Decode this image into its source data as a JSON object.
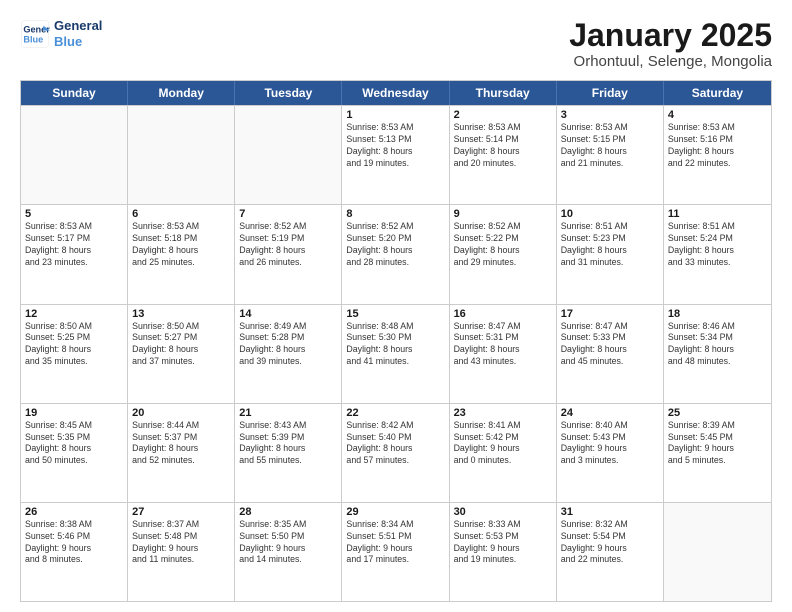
{
  "header": {
    "logo_line1": "General",
    "logo_line2": "Blue",
    "title": "January 2025",
    "subtitle": "Orhontuul, Selenge, Mongolia"
  },
  "weekdays": [
    "Sunday",
    "Monday",
    "Tuesday",
    "Wednesday",
    "Thursday",
    "Friday",
    "Saturday"
  ],
  "weeks": [
    [
      {
        "day": "",
        "info": ""
      },
      {
        "day": "",
        "info": ""
      },
      {
        "day": "",
        "info": ""
      },
      {
        "day": "1",
        "info": "Sunrise: 8:53 AM\nSunset: 5:13 PM\nDaylight: 8 hours\nand 19 minutes."
      },
      {
        "day": "2",
        "info": "Sunrise: 8:53 AM\nSunset: 5:14 PM\nDaylight: 8 hours\nand 20 minutes."
      },
      {
        "day": "3",
        "info": "Sunrise: 8:53 AM\nSunset: 5:15 PM\nDaylight: 8 hours\nand 21 minutes."
      },
      {
        "day": "4",
        "info": "Sunrise: 8:53 AM\nSunset: 5:16 PM\nDaylight: 8 hours\nand 22 minutes."
      }
    ],
    [
      {
        "day": "5",
        "info": "Sunrise: 8:53 AM\nSunset: 5:17 PM\nDaylight: 8 hours\nand 23 minutes."
      },
      {
        "day": "6",
        "info": "Sunrise: 8:53 AM\nSunset: 5:18 PM\nDaylight: 8 hours\nand 25 minutes."
      },
      {
        "day": "7",
        "info": "Sunrise: 8:52 AM\nSunset: 5:19 PM\nDaylight: 8 hours\nand 26 minutes."
      },
      {
        "day": "8",
        "info": "Sunrise: 8:52 AM\nSunset: 5:20 PM\nDaylight: 8 hours\nand 28 minutes."
      },
      {
        "day": "9",
        "info": "Sunrise: 8:52 AM\nSunset: 5:22 PM\nDaylight: 8 hours\nand 29 minutes."
      },
      {
        "day": "10",
        "info": "Sunrise: 8:51 AM\nSunset: 5:23 PM\nDaylight: 8 hours\nand 31 minutes."
      },
      {
        "day": "11",
        "info": "Sunrise: 8:51 AM\nSunset: 5:24 PM\nDaylight: 8 hours\nand 33 minutes."
      }
    ],
    [
      {
        "day": "12",
        "info": "Sunrise: 8:50 AM\nSunset: 5:25 PM\nDaylight: 8 hours\nand 35 minutes."
      },
      {
        "day": "13",
        "info": "Sunrise: 8:50 AM\nSunset: 5:27 PM\nDaylight: 8 hours\nand 37 minutes."
      },
      {
        "day": "14",
        "info": "Sunrise: 8:49 AM\nSunset: 5:28 PM\nDaylight: 8 hours\nand 39 minutes."
      },
      {
        "day": "15",
        "info": "Sunrise: 8:48 AM\nSunset: 5:30 PM\nDaylight: 8 hours\nand 41 minutes."
      },
      {
        "day": "16",
        "info": "Sunrise: 8:47 AM\nSunset: 5:31 PM\nDaylight: 8 hours\nand 43 minutes."
      },
      {
        "day": "17",
        "info": "Sunrise: 8:47 AM\nSunset: 5:33 PM\nDaylight: 8 hours\nand 45 minutes."
      },
      {
        "day": "18",
        "info": "Sunrise: 8:46 AM\nSunset: 5:34 PM\nDaylight: 8 hours\nand 48 minutes."
      }
    ],
    [
      {
        "day": "19",
        "info": "Sunrise: 8:45 AM\nSunset: 5:35 PM\nDaylight: 8 hours\nand 50 minutes."
      },
      {
        "day": "20",
        "info": "Sunrise: 8:44 AM\nSunset: 5:37 PM\nDaylight: 8 hours\nand 52 minutes."
      },
      {
        "day": "21",
        "info": "Sunrise: 8:43 AM\nSunset: 5:39 PM\nDaylight: 8 hours\nand 55 minutes."
      },
      {
        "day": "22",
        "info": "Sunrise: 8:42 AM\nSunset: 5:40 PM\nDaylight: 8 hours\nand 57 minutes."
      },
      {
        "day": "23",
        "info": "Sunrise: 8:41 AM\nSunset: 5:42 PM\nDaylight: 9 hours\nand 0 minutes."
      },
      {
        "day": "24",
        "info": "Sunrise: 8:40 AM\nSunset: 5:43 PM\nDaylight: 9 hours\nand 3 minutes."
      },
      {
        "day": "25",
        "info": "Sunrise: 8:39 AM\nSunset: 5:45 PM\nDaylight: 9 hours\nand 5 minutes."
      }
    ],
    [
      {
        "day": "26",
        "info": "Sunrise: 8:38 AM\nSunset: 5:46 PM\nDaylight: 9 hours\nand 8 minutes."
      },
      {
        "day": "27",
        "info": "Sunrise: 8:37 AM\nSunset: 5:48 PM\nDaylight: 9 hours\nand 11 minutes."
      },
      {
        "day": "28",
        "info": "Sunrise: 8:35 AM\nSunset: 5:50 PM\nDaylight: 9 hours\nand 14 minutes."
      },
      {
        "day": "29",
        "info": "Sunrise: 8:34 AM\nSunset: 5:51 PM\nDaylight: 9 hours\nand 17 minutes."
      },
      {
        "day": "30",
        "info": "Sunrise: 8:33 AM\nSunset: 5:53 PM\nDaylight: 9 hours\nand 19 minutes."
      },
      {
        "day": "31",
        "info": "Sunrise: 8:32 AM\nSunset: 5:54 PM\nDaylight: 9 hours\nand 22 minutes."
      },
      {
        "day": "",
        "info": ""
      }
    ]
  ]
}
